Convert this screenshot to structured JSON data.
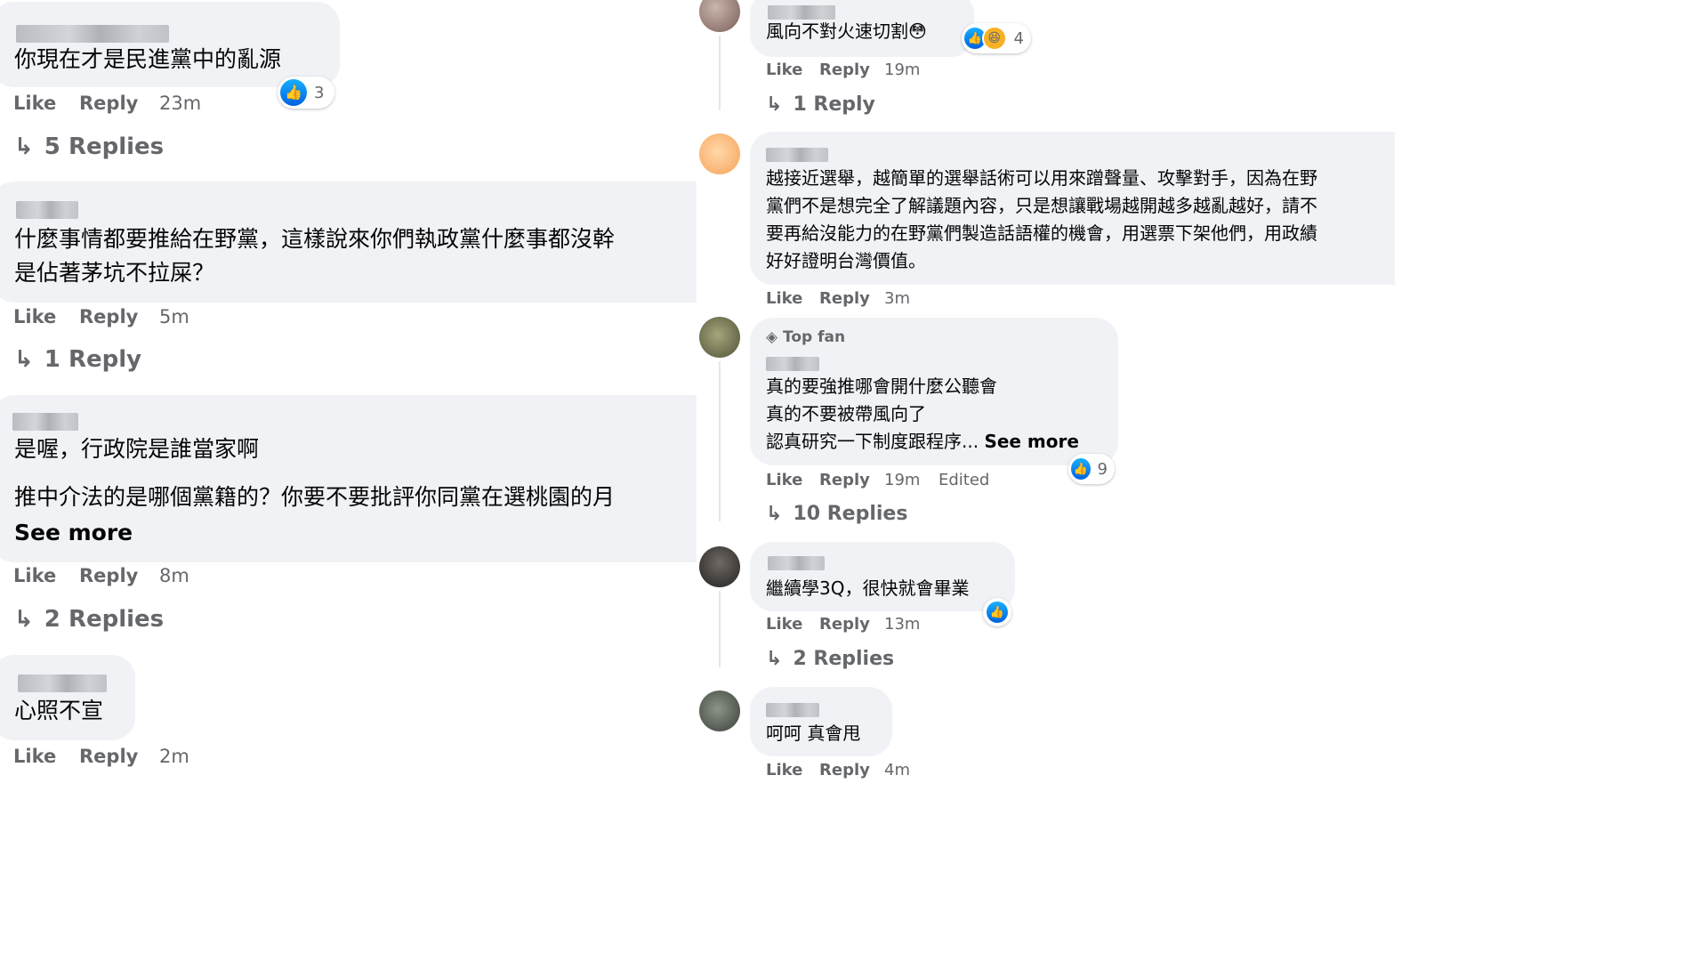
{
  "actions": {
    "like": "Like",
    "reply": "Reply",
    "edited": "Edited",
    "see_more": "See more"
  },
  "left_comments": [
    {
      "text": "你現在才是民進黨中的亂源",
      "reaction_count": "3",
      "time": "23m",
      "replies": "5 Replies"
    },
    {
      "line1": "什麼事情都要推給在野黨，這樣說來你們執政黨什麼事都沒幹",
      "line2": "是佔著茅坑不拉屎？",
      "time": "5m",
      "replies": "1 Reply"
    },
    {
      "line1": "是喔，行政院是誰當家啊",
      "line2": "推中介法的是哪個黨籍的？你要不要批評你同黨在選桃園的月",
      "time": "8m",
      "replies": "2 Replies"
    },
    {
      "text": "心照不宣",
      "time": "2m"
    }
  ],
  "right_comments": [
    {
      "text": "風向不對火速切割",
      "emoji": "😳",
      "reaction_count": "4",
      "time": "19m",
      "replies": "1 Reply"
    },
    {
      "line1": "越接近選舉，越簡單的選舉話術可以用來蹭聲量、攻擊對手，因為在野",
      "line2": "黨們不是想完全了解議題內容，只是想讓戰場越開越多越亂越好，請不",
      "line3": "要再給沒能力的在野黨們製造話語權的機會，用選票下架他們，用政績",
      "line4": "好好證明台灣價值。",
      "time": "3m"
    },
    {
      "badge": "Top fan",
      "line1": "真的要強推哪會開什麼公聽會",
      "line2": "真的不要被帶風向了",
      "line3": "認真研究一下制度跟程序... ",
      "reaction_count": "9",
      "time": "19m",
      "replies": "10 Replies"
    },
    {
      "text": "繼續學3Q，很快就會畢業",
      "time": "13m",
      "replies": "2 Replies"
    },
    {
      "text": "呵呵 真會甩",
      "time": "4m"
    }
  ]
}
